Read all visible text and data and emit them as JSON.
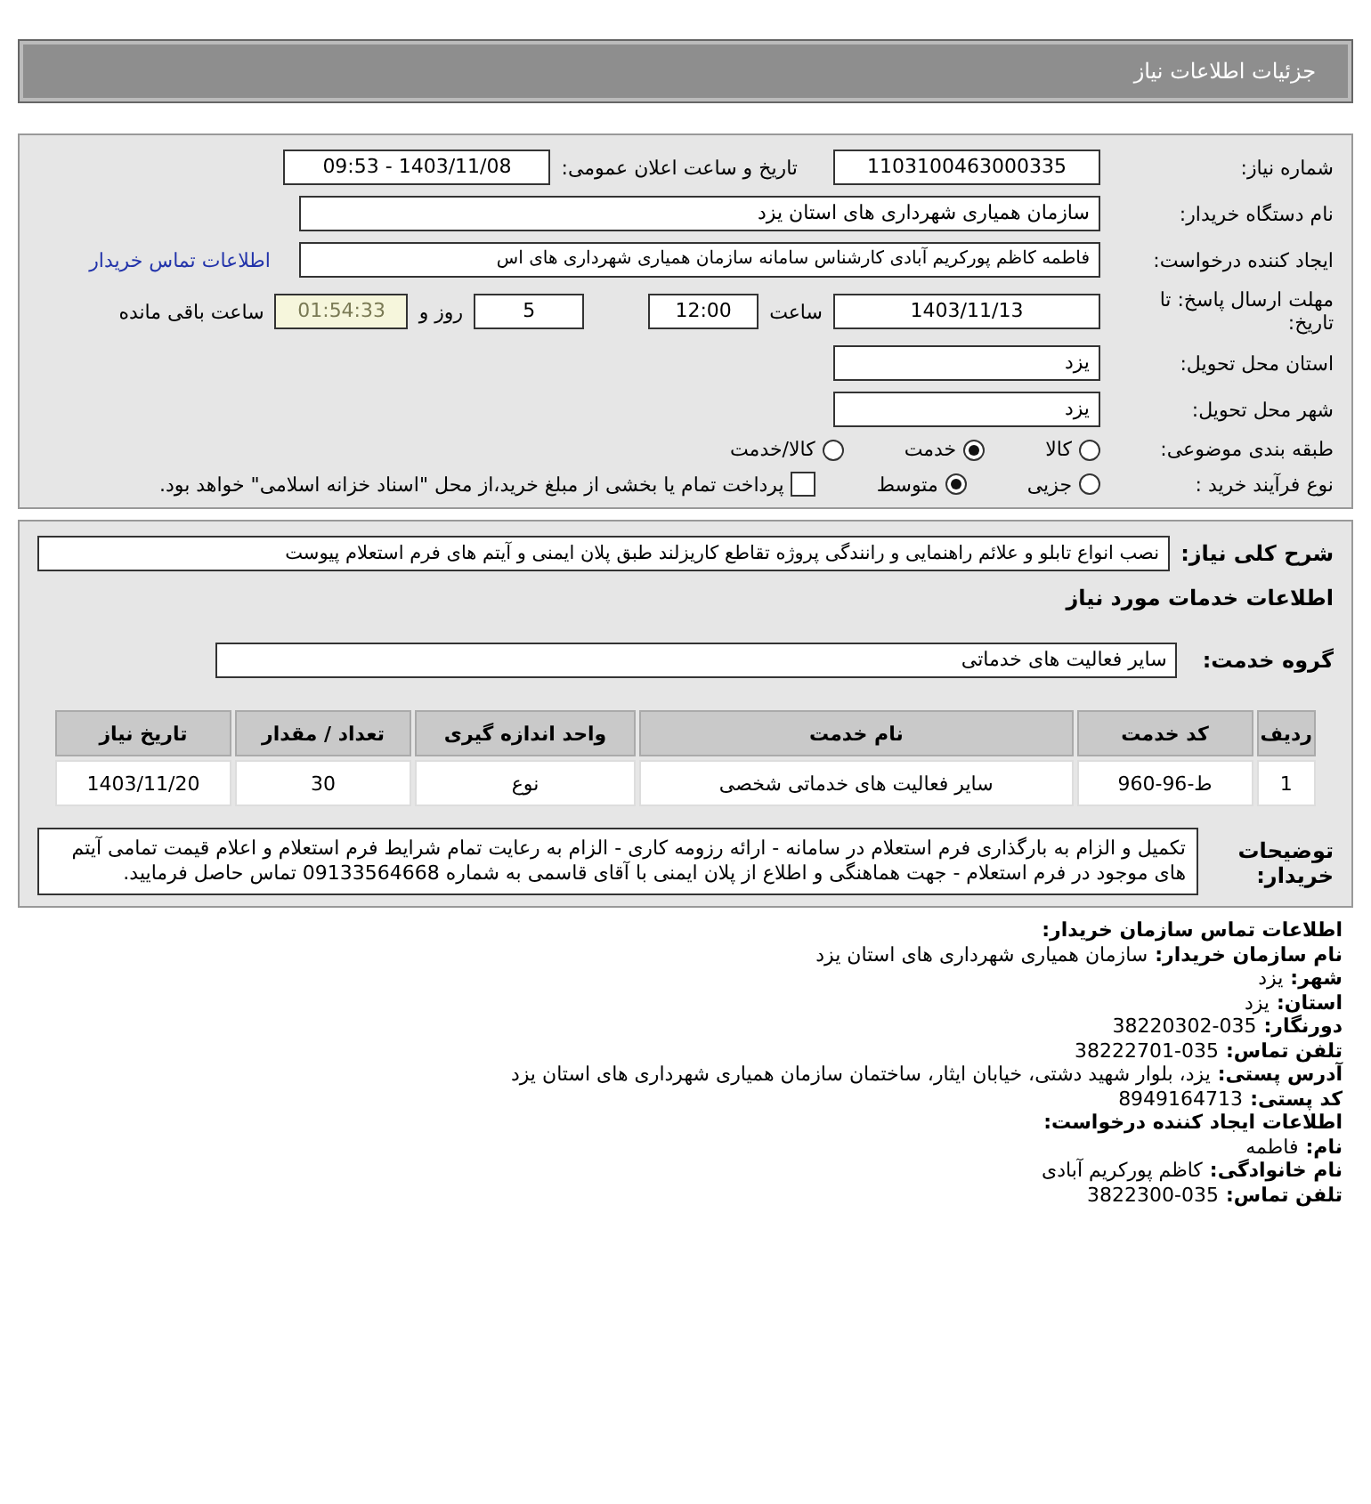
{
  "header": {
    "title": "جزئیات اطلاعات نیاز"
  },
  "need_number": {
    "label": "شماره نیاز:",
    "value": "1103100463000335"
  },
  "announce": {
    "label": "تاریخ و ساعت اعلان عمومی:",
    "value": "1403/11/08 - 09:53"
  },
  "buyer": {
    "label": "نام دستگاه خریدار:",
    "value": "سازمان همیاری شهرداری های استان یزد"
  },
  "requester": {
    "label": "ایجاد کننده درخواست:",
    "value": "فاطمه کاظم پورکریم آبادی کارشناس سامانه سازمان همیاری شهرداری های اس",
    "link": "اطلاعات تماس خریدار"
  },
  "deadline": {
    "label": "مهلت ارسال پاسخ: تا تاریخ:",
    "date": "1403/11/13",
    "time_label": "ساعت",
    "time": "12:00",
    "days": "5",
    "days_label": "روز و",
    "remaining": "01:54:33",
    "remaining_label": "ساعت باقی مانده"
  },
  "province": {
    "label": "استان محل تحویل:",
    "value": "یزد"
  },
  "city": {
    "label": "شهر محل تحویل:",
    "value": "یزد"
  },
  "category": {
    "label": "طبقه بندی موضوعی:",
    "options": [
      {
        "label": "کالا",
        "selected": false
      },
      {
        "label": "خدمت",
        "selected": true
      },
      {
        "label": "کالا/خدمت",
        "selected": false
      }
    ]
  },
  "process": {
    "label": "نوع فرآیند خرید :",
    "options": [
      {
        "label": "جزیی",
        "selected": false
      },
      {
        "label": "متوسط",
        "selected": true
      }
    ],
    "treasury": {
      "checked": false,
      "label": "پرداخت تمام یا بخشی از مبلغ خرید،از محل \"اسناد خزانه اسلامی\" خواهد بود."
    }
  },
  "description": {
    "label": "شرح کلی نیاز:",
    "value": "نصب انواع تابلو و علائم راهنمایی و رانندگی پروژه تقاطع کاریزلند طبق پلان ایمنی و آیتم های فرم استعلام پیوست"
  },
  "services_title": "اطلاعات خدمات مورد نیاز",
  "service_group": {
    "label": "گروه خدمت:",
    "value": "سایر فعالیت های خدماتی"
  },
  "table": {
    "columns": [
      "ردیف",
      "کد خدمت",
      "نام خدمت",
      "واحد اندازه گیری",
      "تعداد / مقدار",
      "تاریخ نیاز"
    ],
    "rows": [
      [
        "1",
        "ط-96-960",
        "سایر فعالیت های خدماتی شخصی",
        "نوع",
        "30",
        "1403/11/20"
      ]
    ]
  },
  "notes": {
    "label": "توضیحات خریدار:",
    "value": "تکمیل و الزام به بارگذاری فرم استعلام در سامانه - ارائه رزومه کاری - الزام به رعایت تمام شرایط فرم استعلام و اعلام قیمت تمامی آیتم های موجود در فرم استعلام - جهت هماهنگی و اطلاع از پلان ایمنی با آقای قاسمی به شماره 09133564668 تماس حاصل فرمایید."
  },
  "contact": [
    {
      "kind": "heading",
      "label": "اطلاعات تماس سازمان خریدار:"
    },
    {
      "kind": "line",
      "label": "نام سازمان خریدار:",
      "value": "سازمان همیاری شهرداری های استان یزد"
    },
    {
      "kind": "line",
      "label": "شهر:",
      "value": "یزد"
    },
    {
      "kind": "line",
      "label": "استان:",
      "value": "یزد"
    },
    {
      "kind": "line",
      "label": "دورنگار:",
      "value": "035-38220302"
    },
    {
      "kind": "line",
      "label": "تلفن تماس:",
      "value": "035-38222701"
    },
    {
      "kind": "line",
      "label": "آدرس پستی:",
      "value": "یزد، بلوار شهید دشتی، خیابان ایثار، ساختمان سازمان همیاری شهرداری های استان یزد"
    },
    {
      "kind": "line",
      "label": "کد پستی:",
      "value": "8949164713"
    },
    {
      "kind": "heading",
      "label": "اطلاعات ایجاد کننده درخواست:"
    },
    {
      "kind": "line",
      "label": "نام:",
      "value": "فاطمه"
    },
    {
      "kind": "line",
      "label": "نام خانوادگی:",
      "value": "کاظم پورکریم آبادی"
    },
    {
      "kind": "line",
      "label": "تلفن تماس:",
      "value": "035-3822300"
    }
  ]
}
